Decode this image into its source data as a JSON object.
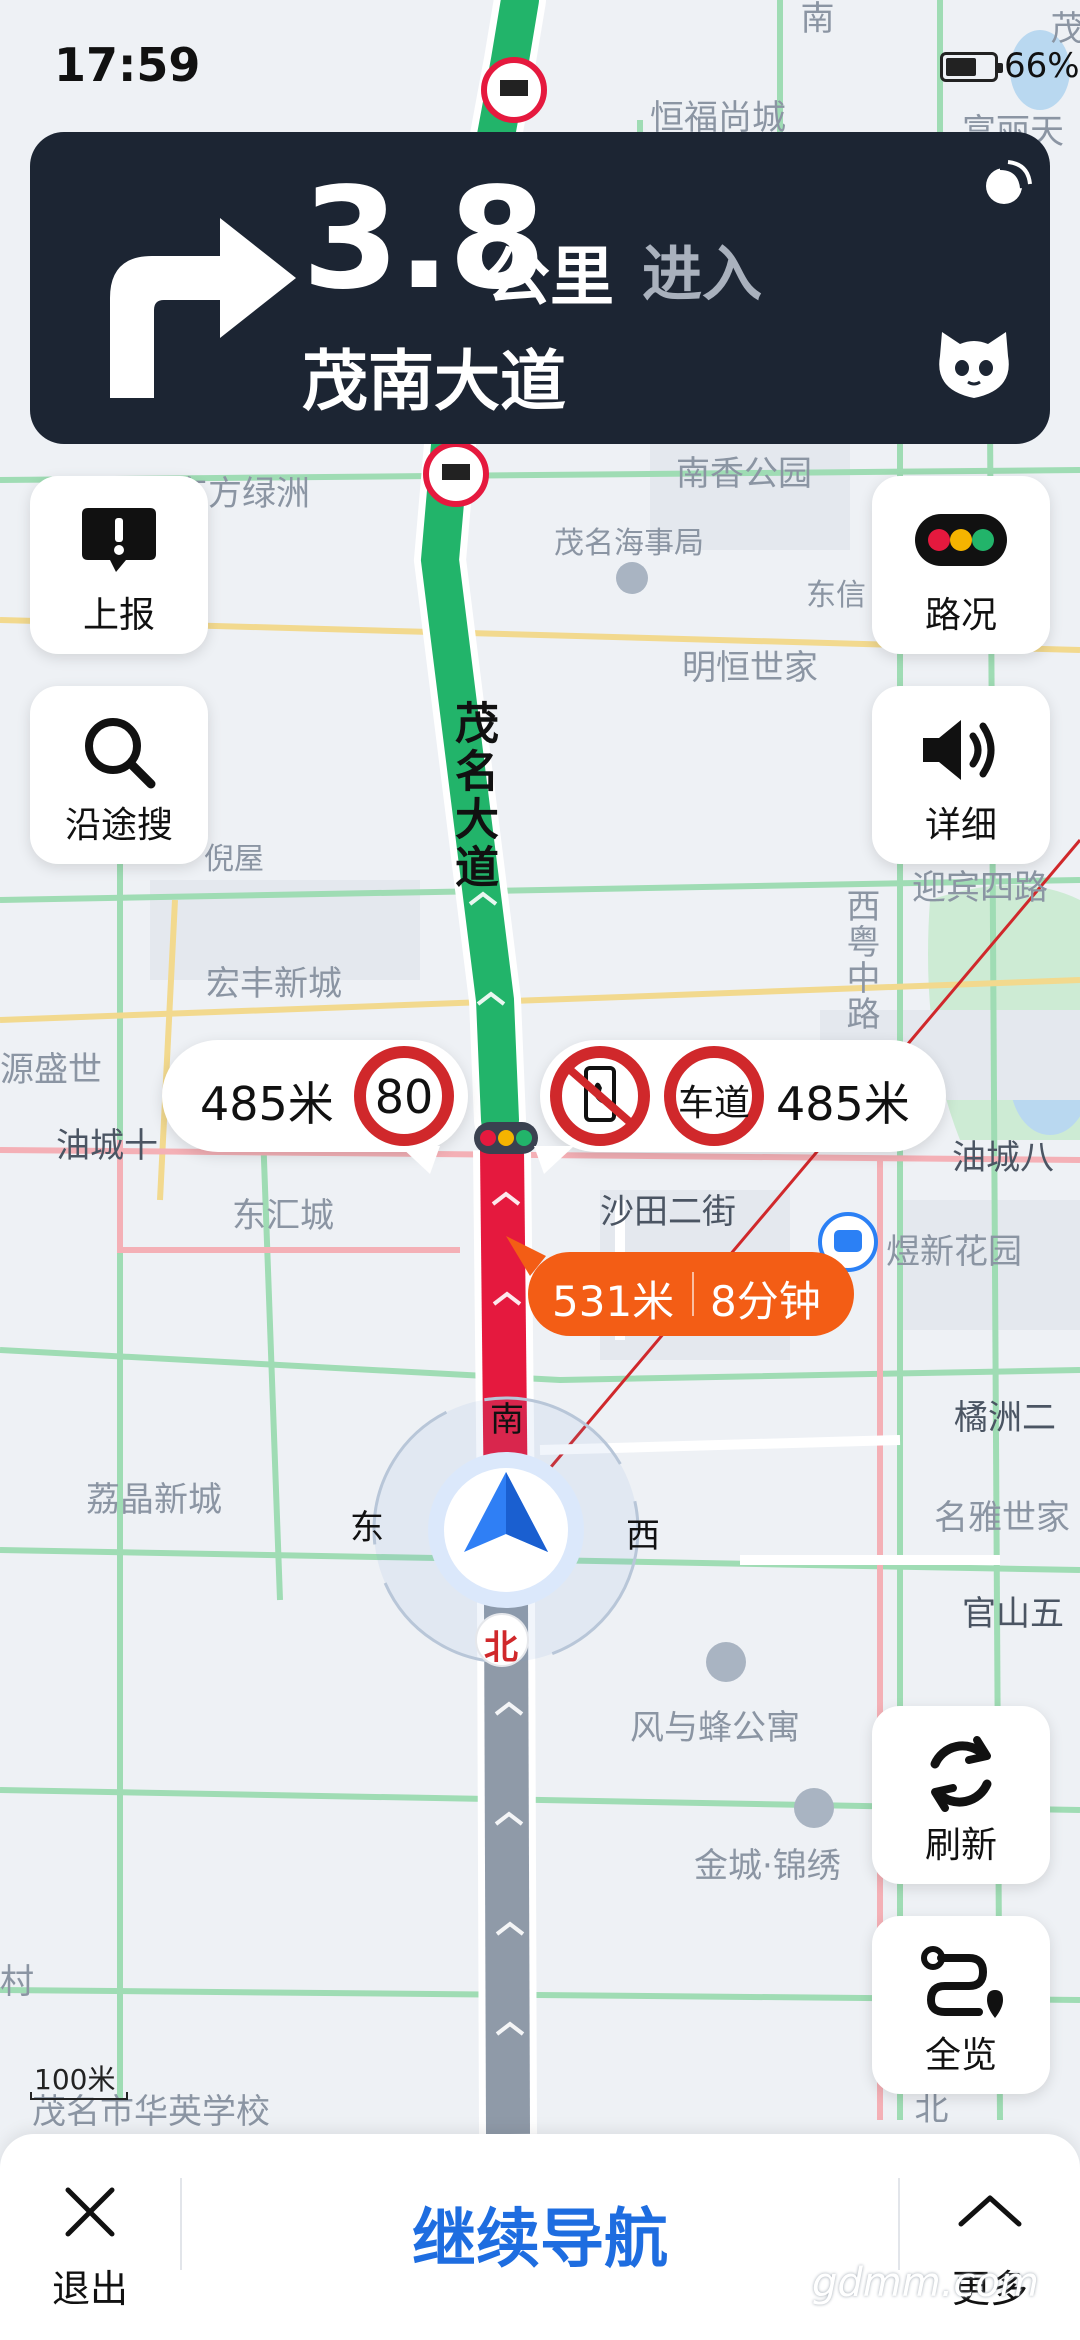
{
  "status_bar": {
    "time": "17:59",
    "battery": "66%",
    "battery_level": 0.66
  },
  "guidance": {
    "distance": "3.8",
    "unit": "公里",
    "action": "进入",
    "road": "茂南大道"
  },
  "buttons": {
    "report": "上报",
    "search_along": "沿途搜",
    "traffic": "路况",
    "detail": "详细",
    "refresh": "刷新",
    "overview": "全览"
  },
  "callouts": {
    "speed_distance": "485米",
    "speed_limit": "80",
    "lane_label": "车道",
    "lane_distance": "485米"
  },
  "congestion": {
    "distance": "531米",
    "time": "8分钟"
  },
  "compass": {
    "south": "南",
    "east": "东",
    "west": "西",
    "north": "北"
  },
  "map_labels": {
    "current_road": "茂名大道",
    "hengfu": "恒福尚城",
    "fuli": "富丽天",
    "nanxiang": "南香公园",
    "dongfang": "东方绿洲",
    "maritime": "茂名海事局",
    "dongxin": "东信",
    "mingheng": "明恒世家",
    "niwu": "倪屋",
    "yingbin": "迎宾四路",
    "xiyue": "西粤中路",
    "hongfeng": "宏丰新城",
    "yuansheng": "源盛世",
    "youcheng_w": "油城十",
    "youcheng_e": "油城八",
    "donghui": "东汇城",
    "shatian": "沙田二街",
    "yuxin": "煜新花园",
    "lijing": "荔晶新城",
    "juzhou": "橘洲二",
    "mingya": "名雅世家",
    "guanshan": "官山五",
    "fengyufeng": "风与蜂公寓",
    "jincheng": "金城·锦绣",
    "huaying": "茂名市华英学校",
    "nan_top": "南",
    "mao_top": "茂",
    "bei": "北",
    "cun": "村"
  },
  "scale": "100米",
  "bottom_bar": {
    "exit": "退出",
    "continue": "继续导航",
    "more": "更多"
  },
  "watermark": "gdmm.com",
  "colors": {
    "route_green": "#22b46a",
    "route_red": "#e5193e",
    "route_gray": "#8f9aa8",
    "nav_bg": "#1c2533",
    "accent_blue": "#1e6de0",
    "congestion_orange": "#f35d15"
  }
}
